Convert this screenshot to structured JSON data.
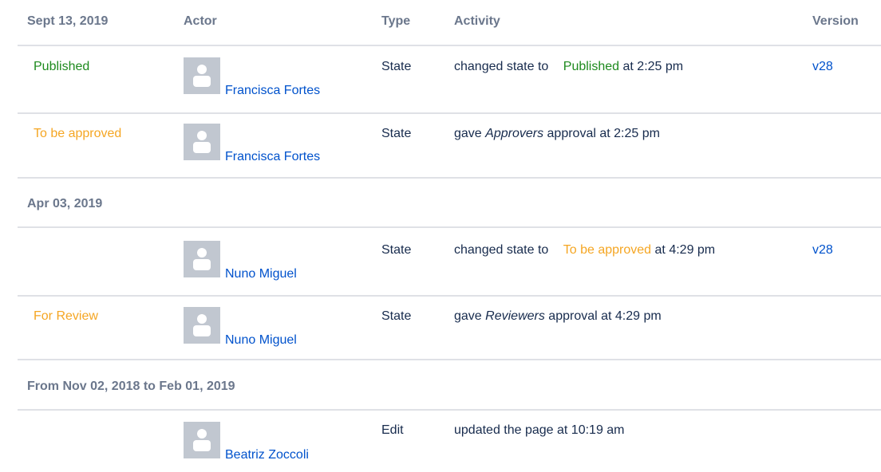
{
  "headers": {
    "date": "Sept 13, 2019",
    "actor": "Actor",
    "type": "Type",
    "activity": "Activity",
    "version": "Version"
  },
  "groups": [
    {
      "label": "Sept 13, 2019",
      "rows": [
        {
          "state_label": "Published",
          "actor": "Francisca Fortes",
          "type": "State",
          "activity_prefix": "changed state to",
          "activity_state": "Published",
          "activity_suffix": "at 2:25 pm",
          "version": "v28"
        },
        {
          "state_label": "To be approved",
          "actor": "Francisca Fortes",
          "type": "State",
          "activity_prefix": "gave",
          "activity_emph": "Approvers",
          "activity_suffix": "approval at 2:25 pm",
          "version": ""
        }
      ]
    },
    {
      "label": "Apr 03, 2019",
      "rows": [
        {
          "state_label": "",
          "actor": "Nuno Miguel",
          "type": "State",
          "activity_prefix": "changed state to",
          "activity_state": "To be approved",
          "activity_suffix": "at 4:29 pm",
          "version": "v28"
        },
        {
          "state_label": "For Review",
          "actor": "Nuno Miguel",
          "type": "State",
          "activity_prefix": "gave",
          "activity_emph": "Reviewers",
          "activity_suffix": "approval at 4:29 pm",
          "version": ""
        }
      ]
    },
    {
      "label": "From Nov 02, 2018 to Feb 01, 2019",
      "rows": [
        {
          "state_label": "",
          "actor": "Beatriz Zoccoli",
          "type": "Edit",
          "activity_text": "updated the page at 10:19 am",
          "version": ""
        }
      ]
    }
  ],
  "colors": {
    "state_published": "#1e8a1e",
    "state_pending": "#f5a623",
    "link": "#0052cc",
    "header_text": "#6b778c",
    "divider": "#dfe1e6",
    "avatar_bg": "#c1c7d0"
  },
  "icons": {
    "avatar": "default-user-avatar-icon"
  }
}
